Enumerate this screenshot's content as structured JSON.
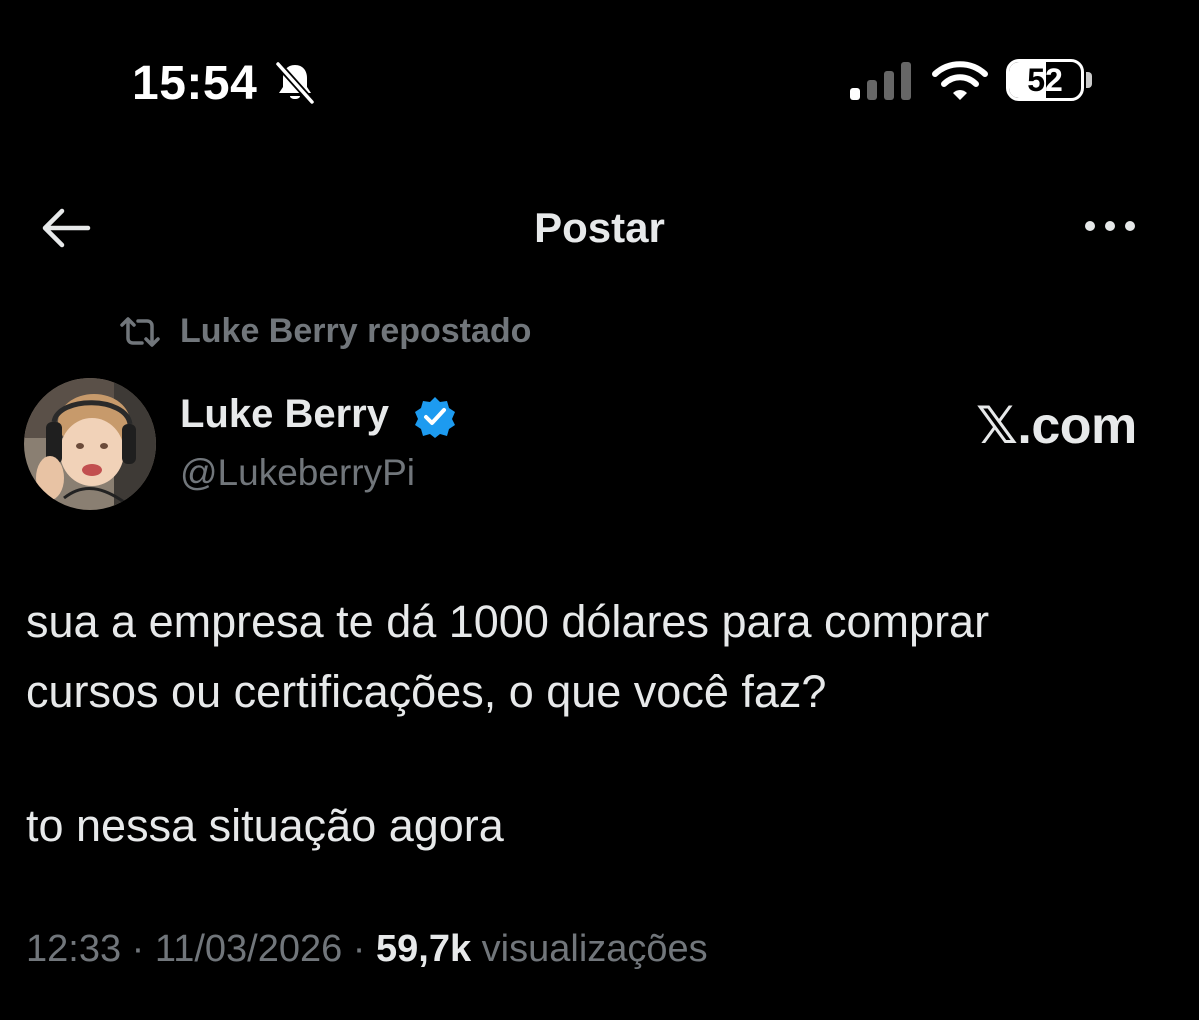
{
  "status_bar": {
    "time": "15:54",
    "battery": "52",
    "battery_level": 0.52,
    "icons": [
      "bell-slash-icon",
      "signal-icon",
      "wifi-icon",
      "battery-icon"
    ]
  },
  "header": {
    "title": "Postar",
    "back_icon": "arrow-left-icon",
    "more_icon": "more-horizontal-icon"
  },
  "repost": {
    "icon": "repost-icon",
    "text": "Luke Berry repostado"
  },
  "author": {
    "name": "Luke Berry",
    "handle": "@LukeberryPi",
    "verified": true
  },
  "watermark": "𝕏.com",
  "tweet": {
    "lines": [
      "sua a empresa te dá 1000 dólares para comprar",
      "cursos ou certificações, o que você faz?",
      "to nessa situação agora"
    ]
  },
  "meta": {
    "time": "12:33",
    "separator": " · ",
    "date": "11/03/2026",
    "views": "59,7k",
    "views_label": " visualizações"
  },
  "colors": {
    "background": "#000000",
    "text": "#e7e9ea",
    "muted": "#71767b",
    "verified": "#1d9bf0"
  }
}
